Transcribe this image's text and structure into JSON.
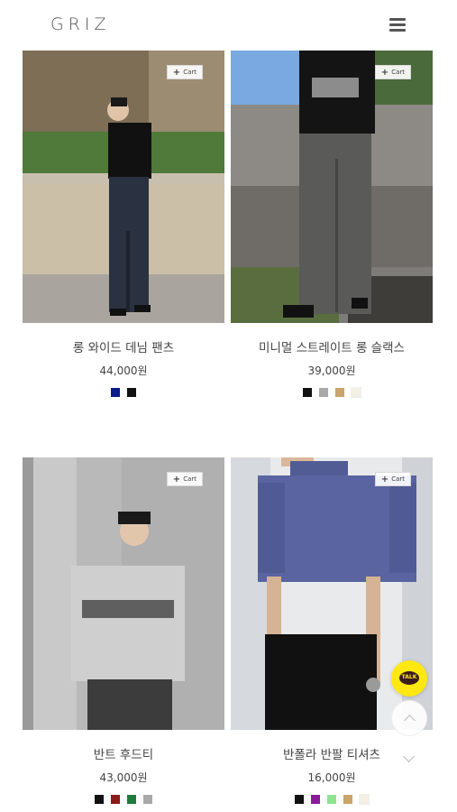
{
  "header": {
    "logo": "GRIZ",
    "menu_icon": "hamburger-menu-icon"
  },
  "products": [
    {
      "name": "롱 와이드 데님 팬츠",
      "price": "44,000원",
      "cart_label": "Cart",
      "colors": [
        "#0d1a8c",
        "#111111"
      ]
    },
    {
      "name": "미니멀 스트레이트 롱 슬랙스",
      "price": "39,000원",
      "cart_label": "Cart",
      "colors": [
        "#111111",
        "#a9a9a9",
        "#c9a56b",
        "#f4f0e4"
      ]
    },
    {
      "name": "반트 후드티",
      "price": "43,000원",
      "cart_label": "Cart",
      "colors": [
        "#111111",
        "#8b1a1a",
        "#1e7a3c",
        "#a9a9a9"
      ]
    },
    {
      "name": "반폴라 반팔 티셔츠",
      "price": "16,000원",
      "cart_label": "Cart",
      "colors": [
        "#111111",
        "#8a1a9a",
        "#8fe38f",
        "#c9a56b",
        "#f4f0e4"
      ]
    }
  ],
  "floating": {
    "talk_label": "TALK",
    "talk_color": "#ffe812"
  }
}
